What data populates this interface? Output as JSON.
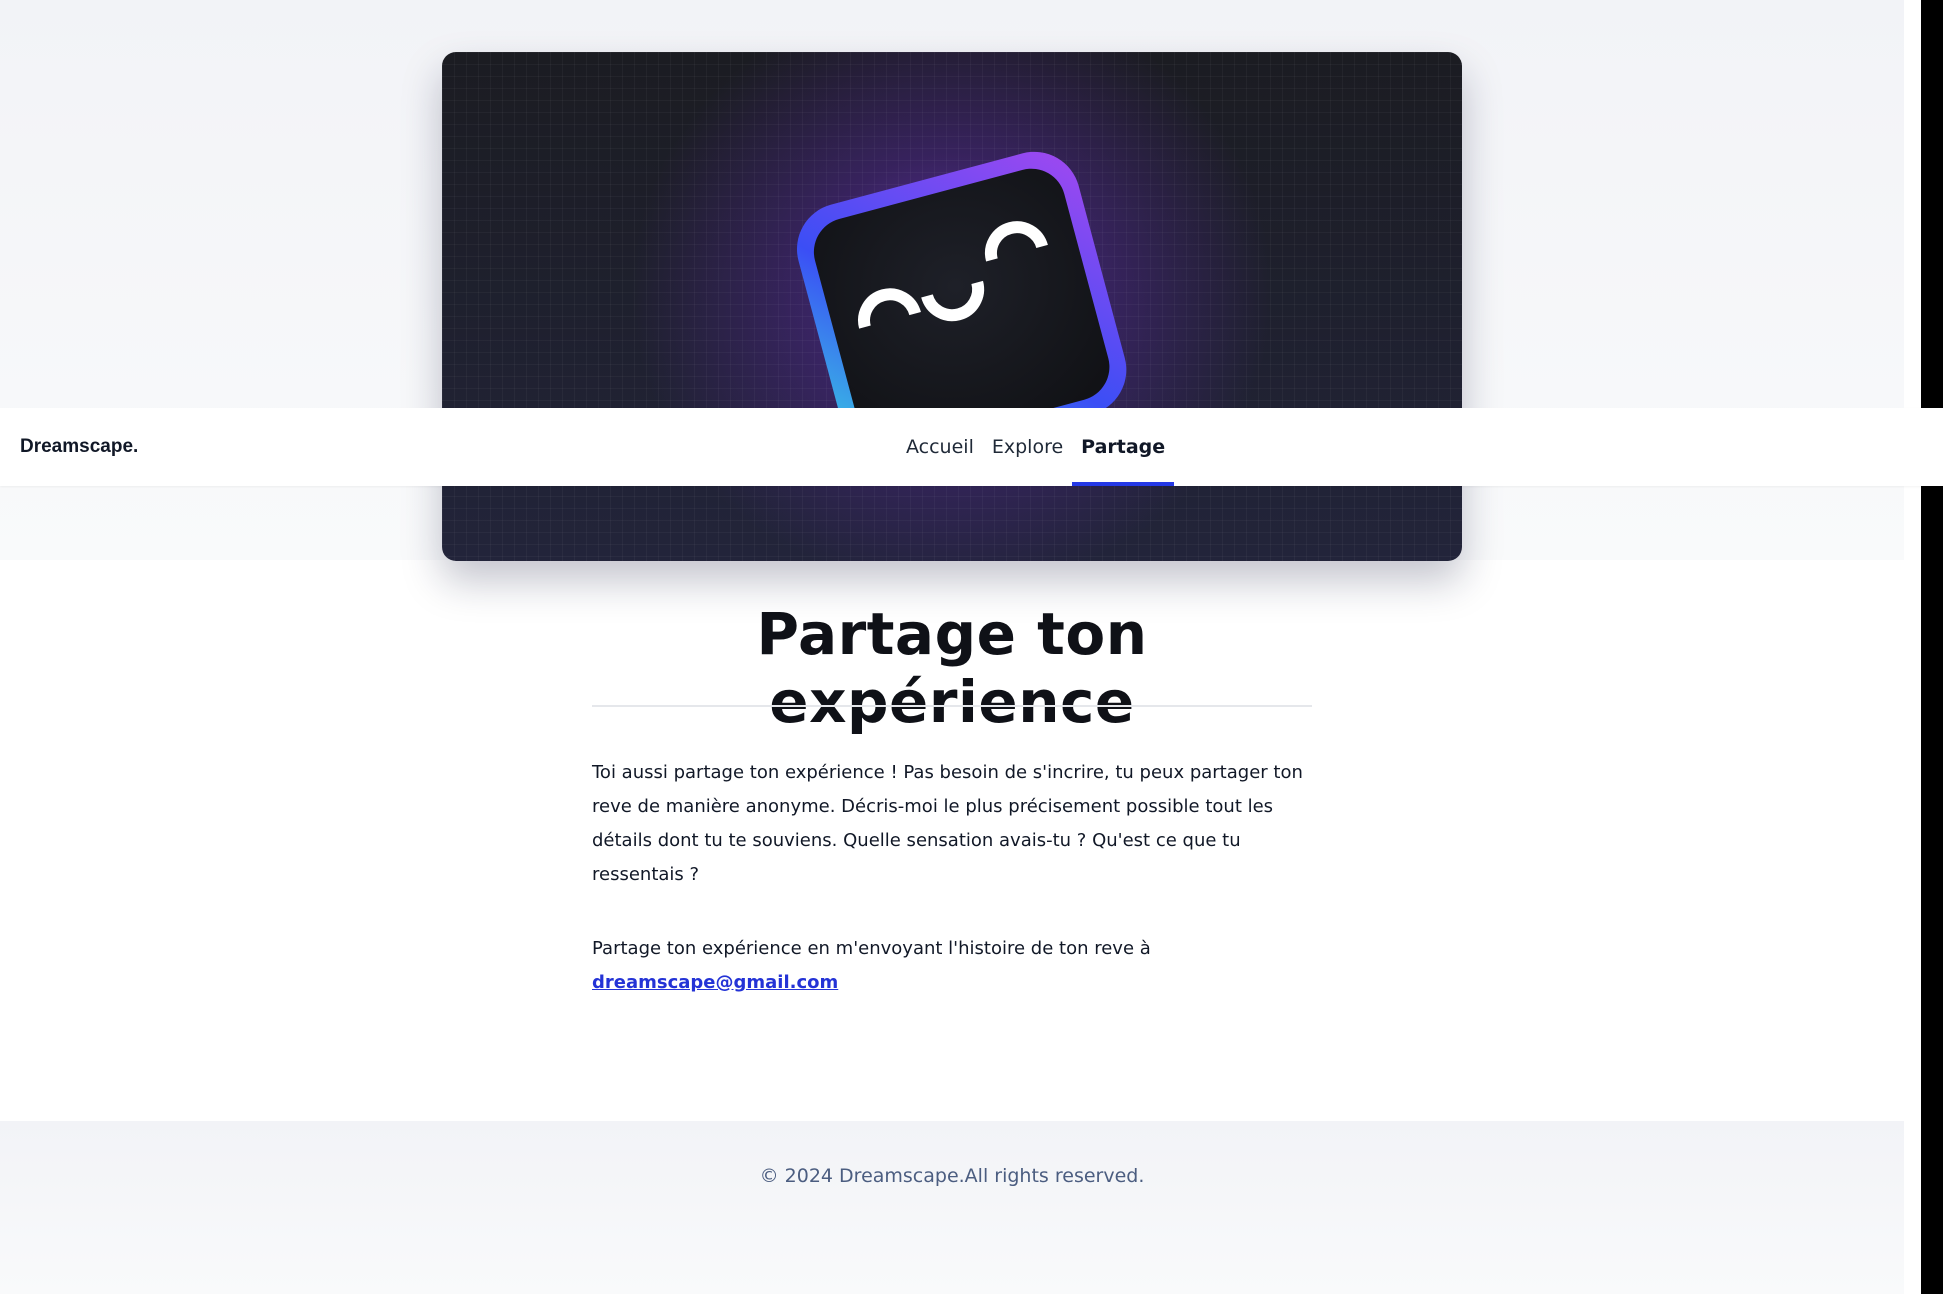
{
  "brand": "Dreamscape.",
  "nav": {
    "items": [
      "Accueil",
      "Explore",
      "Partage"
    ],
    "active": "Partage"
  },
  "hero": {
    "image": "robot-mascot-banner"
  },
  "main": {
    "title": "Partage ton expérience",
    "paragraph1": "Toi aussi partage ton expérience ! Pas besoin de s'incrire, tu peux partager ton reve de manière anonyme. Décris-moi le plus précisement possible tout les détails dont tu te souviens. Quelle sensation avais-tu ? Qu'est ce que tu ressentais ?",
    "paragraph2": "Partage ton expérience en m'envoyant l'histoire de ton reve à",
    "email": "dreamscape@gmail.com"
  },
  "footer": {
    "copyright": "© 2024 Dreamscape.All rights reserved."
  },
  "colors": {
    "accent": "#2438e6",
    "link": "#2433d6",
    "text": "#111827",
    "footer_text": "#4b5d80"
  }
}
